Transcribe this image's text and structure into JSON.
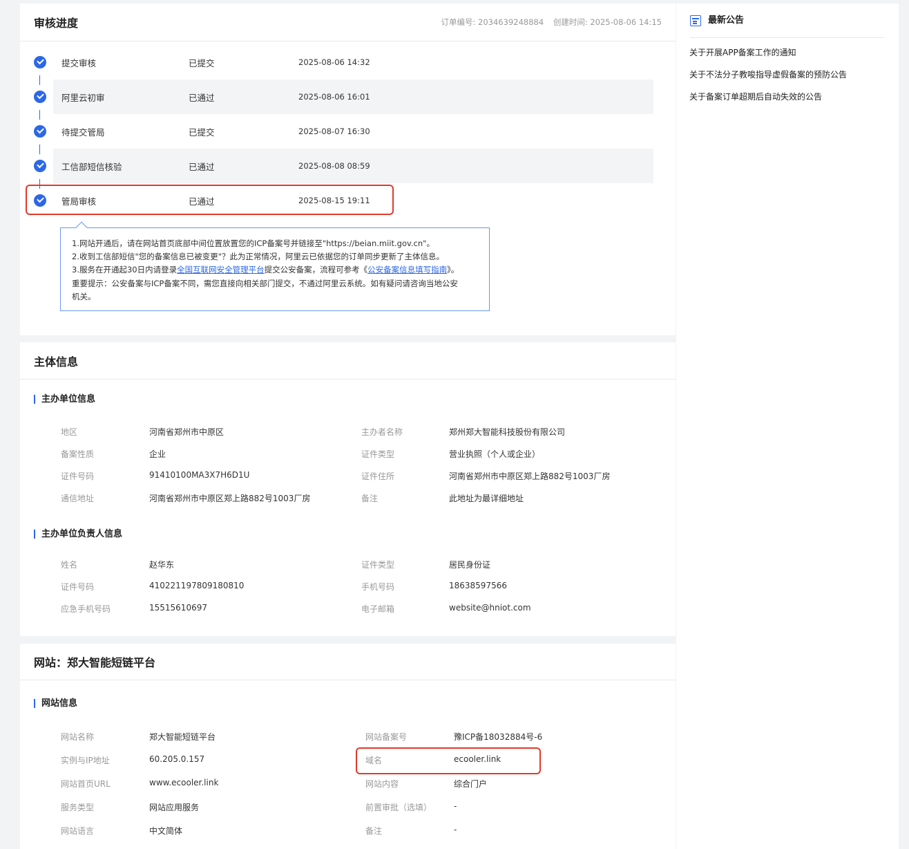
{
  "progress": {
    "title": "审核进度",
    "order_no": "订单编号: 2034639248884",
    "created": "创建时间: 2025-08-06 14:15",
    "steps": [
      {
        "name": "提交审核",
        "status": "已提交",
        "time": "2025-08-06 14:32"
      },
      {
        "name": "阿里云初审",
        "status": "已通过",
        "time": "2025-08-06 16:01"
      },
      {
        "name": "待提交管局",
        "status": "已提交",
        "time": "2025-08-07 16:30"
      },
      {
        "name": "工信部短信核验",
        "status": "已通过",
        "time": "2025-08-08 08:59"
      },
      {
        "name": "管局审核",
        "status": "已通过",
        "time": "2025-08-15 19:11"
      }
    ],
    "tip": {
      "line1": "1.网站开通后，请在网站首页底部中间位置放置您的ICP备案号并链接至\"https://beian.miit.gov.cn\"。",
      "line2": "2.收到工信部短信\"您的备案信息已被变更\"？此为正常情况，阿里云已依据您的订单同步更新了主体信息。",
      "line3_a": "3.服务在开通起30日内请登录",
      "line3_link1": "全国互联网安全管理平台",
      "line3_b": "提交公安备案，流程可参考《",
      "line3_link2": "公安备案信息填写指南",
      "line3_c": "》。",
      "line4": "重要提示：公安备案与ICP备案不同，需您直接向相关部门提交，不通过阿里云系统。如有疑问请咨询当地公安",
      "line5": "机关。"
    }
  },
  "subject": {
    "title": "主体信息",
    "org_section": "主办单位信息",
    "org": [
      {
        "k": "地区",
        "v": "河南省郑州市中原区"
      },
      {
        "k": "主办者名称",
        "v": "郑州郑大智能科技股份有限公司"
      },
      {
        "k": "备案性质",
        "v": "企业"
      },
      {
        "k": "证件类型",
        "v": "营业执照（个人或企业）"
      },
      {
        "k": "证件号码",
        "v": "91410100MA3X7H6D1U"
      },
      {
        "k": "证件住所",
        "v": "河南省郑州市中原区郑上路882号1003厂房"
      },
      {
        "k": "通信地址",
        "v": "河南省郑州市中原区郑上路882号1003厂房"
      },
      {
        "k": "备注",
        "v": "此地址为最详细地址"
      }
    ],
    "person_section": "主办单位负责人信息",
    "person": [
      {
        "k": "姓名",
        "v": "赵华东"
      },
      {
        "k": "证件类型",
        "v": "居民身份证"
      },
      {
        "k": "证件号码",
        "v": "410221197809180810"
      },
      {
        "k": "手机号码",
        "v": "18638597566"
      },
      {
        "k": "应急手机号码",
        "v": "15515610697"
      },
      {
        "k": "电子邮箱",
        "v": "website@hniot.com"
      }
    ]
  },
  "site": {
    "title": "网站：郑大智能短链平台",
    "section": "网站信息",
    "items": [
      {
        "k": "网站名称",
        "v": "郑大智能短链平台"
      },
      {
        "k": "网站备案号",
        "v": "豫ICP备18032884号-6"
      },
      {
        "k": "实例与IP地址",
        "v": "60.205.0.157"
      },
      {
        "k": "域名",
        "v": "ecooler.link"
      },
      {
        "k": "网站首页URL",
        "v": "www.ecooler.link"
      },
      {
        "k": "网站内容",
        "v": "综合门户"
      },
      {
        "k": "服务类型",
        "v": "网站应用服务"
      },
      {
        "k": "前置审批（选填）",
        "v": "-"
      },
      {
        "k": "网站语言",
        "v": "中文简体"
      },
      {
        "k": "备注",
        "v": "-"
      }
    ]
  },
  "sidebar": {
    "title": "最新公告",
    "icon": "calendar-icon",
    "items": [
      "关于开展APP备案工作的通知",
      "关于不法分子教唆指导虚假备案的预防公告",
      "关于备案订单超期后自动失效的公告"
    ]
  },
  "colors": {
    "accent": "#2c67e6",
    "highlight": "#e03a2a"
  }
}
